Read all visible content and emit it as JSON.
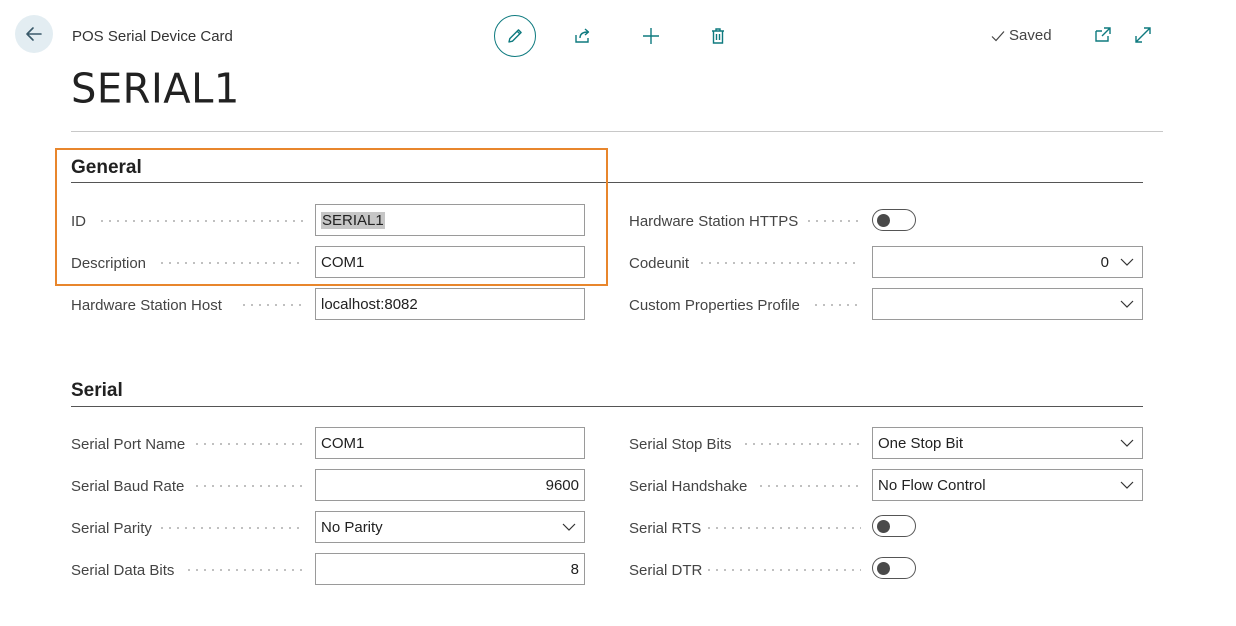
{
  "header": {
    "breadcrumb": "POS Serial Device Card",
    "title": "SERIAL1",
    "saved_label": "Saved"
  },
  "colors": {
    "accent": "#0e7a7f",
    "highlight": "#e8862c"
  },
  "icons": {
    "back": "back-arrow-icon",
    "edit": "pencil-icon",
    "share": "share-icon",
    "add": "plus-icon",
    "delete": "trash-icon",
    "saved": "checkmark-icon",
    "open_new_window": "open-new-window-icon",
    "expand": "expand-icon",
    "dropdown": "chevron-down-icon"
  },
  "general": {
    "title": "General",
    "id": {
      "label": "ID",
      "value": "SERIAL1"
    },
    "description": {
      "label": "Description",
      "value": "COM1"
    },
    "host": {
      "label": "Hardware Station Host",
      "value": "localhost:8082"
    },
    "https": {
      "label": "Hardware Station HTTPS",
      "value": false
    },
    "codeunit": {
      "label": "Codeunit",
      "value": "0"
    },
    "custom_profile": {
      "label": "Custom Properties Profile",
      "value": ""
    }
  },
  "serial": {
    "title": "Serial",
    "port_name": {
      "label": "Serial Port Name",
      "value": "COM1"
    },
    "baud_rate": {
      "label": "Serial Baud Rate",
      "value": "9600"
    },
    "parity": {
      "label": "Serial Parity",
      "value": "No Parity"
    },
    "data_bits": {
      "label": "Serial Data Bits",
      "value": "8"
    },
    "stop_bits": {
      "label": "Serial Stop Bits",
      "value": "One Stop Bit"
    },
    "handshake": {
      "label": "Serial Handshake",
      "value": "No Flow Control"
    },
    "rts": {
      "label": "Serial RTS",
      "value": false
    },
    "dtr": {
      "label": "Serial DTR",
      "value": false
    }
  }
}
